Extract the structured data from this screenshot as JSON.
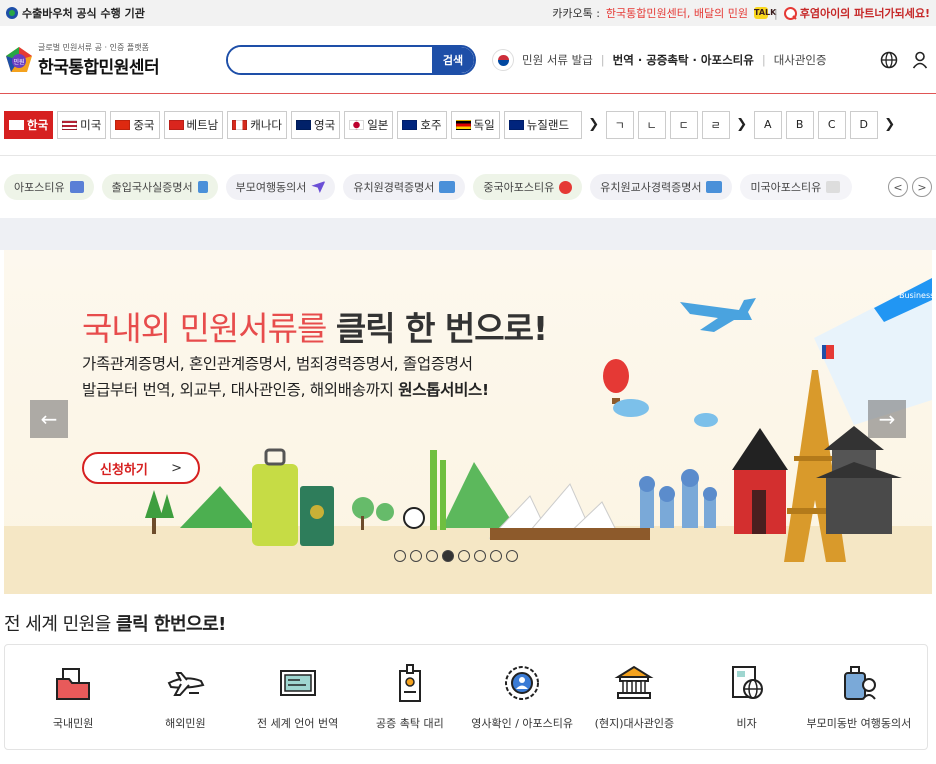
{
  "topbar": {
    "left_text": "수출바우처 공식 수행 기관",
    "kakao_label": "카카오톡 :",
    "kakao_text": "한국통합민원센터, 배달의 민원",
    "divider": "|",
    "partner_text": "후염아이의 파트너가되세요!"
  },
  "header": {
    "logo_sub": "글로벌 민원서류 공 · 인증 플랫폼",
    "logo_main": "한국통합민원센터",
    "logo_badge": "민원",
    "search_placeholder": "",
    "search_button": "검색",
    "nav": {
      "issue": "민원 서류 발급",
      "sep": "|",
      "translation": "번역 · 공증촉탁 · 아포스티유",
      "embassy": "대사관인증"
    }
  },
  "countries": [
    {
      "label": "한국",
      "active": true
    },
    {
      "label": "미국",
      "active": false
    },
    {
      "label": "중국",
      "active": false
    },
    {
      "label": "베트남",
      "active": false
    },
    {
      "label": "캐나다",
      "active": false
    },
    {
      "label": "영국",
      "active": false
    },
    {
      "label": "일본",
      "active": false
    },
    {
      "label": "호주",
      "active": false
    },
    {
      "label": "독일",
      "active": false
    },
    {
      "label": "뉴질랜드",
      "active": false
    }
  ],
  "consonants": [
    "ㄱ",
    "ㄴ",
    "ㄷ",
    "ㄹ"
  ],
  "letters": [
    "A",
    "B",
    "C",
    "D"
  ],
  "chips": [
    {
      "label": "아포스티유",
      "bg": "#eef4e8",
      "icon": "#5a7fd6"
    },
    {
      "label": "출입국사실증명서",
      "bg": "#eef4e8",
      "icon": "#4a90d9"
    },
    {
      "label": "부모여행동의서",
      "bg": "#f1f1f6",
      "icon": "#6b4fd6"
    },
    {
      "label": "유치원경력증명서",
      "bg": "#f1f1f6",
      "icon": "#4a90d9"
    },
    {
      "label": "중국아포스티유",
      "bg": "#eef4e8",
      "icon": "#e53935"
    },
    {
      "label": "유치원교사경력증명서",
      "bg": "#f1f1f6",
      "icon": "#4a90d9"
    },
    {
      "label": "미국아포스티유",
      "bg": "#f4f4f8",
      "icon": "#dddddd"
    }
  ],
  "banner": {
    "title_light": "국내외 민원서류를",
    "title_bold": "클릭 한 번으로!",
    "line1": "가족관계증명서, 혼인관계증명서, 범죄경력증명서, 졸업증명서",
    "line2_a": "발급부터 번역, 외교부, 대사관인증, 해외배송까지",
    "line2_b": "원스톱서비스!",
    "apply_label": "신청하기",
    "apply_arrow": ">",
    "prev_arrow": "←",
    "next_arrow": "→",
    "ticket_label": "Business",
    "dots": 8,
    "active_dot": 3
  },
  "section": {
    "title_light": "전 세계 민원을",
    "title_bold": "클릭 한번으로!"
  },
  "services": [
    {
      "label": "국내민원",
      "icon": "folder-icon"
    },
    {
      "label": "해외민원",
      "icon": "airplane-icon"
    },
    {
      "label": "전 세계 언어 번역",
      "icon": "certificate-icon"
    },
    {
      "label": "공증 촉탁 대리",
      "icon": "badge-icon"
    },
    {
      "label": "영사확인 / 아포스티유",
      "icon": "seal-icon"
    },
    {
      "label": "(현지)대사관인증",
      "icon": "embassy-icon"
    },
    {
      "label": "비자",
      "icon": "visa-icon"
    },
    {
      "label": "부모미동반 여행동의서",
      "icon": "luggage-icon"
    }
  ],
  "colors": {
    "brand_blue": "#1e4fa8",
    "brand_red": "#d62020",
    "title_red": "#e74c4c"
  }
}
